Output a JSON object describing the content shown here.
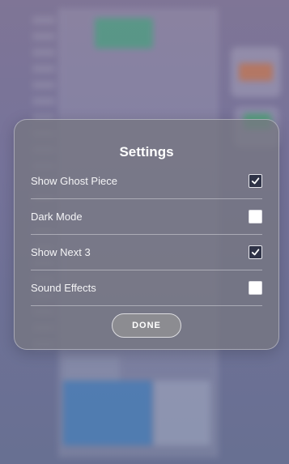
{
  "dialog": {
    "title": "Settings",
    "done_label": "DONE"
  },
  "settings": [
    {
      "label": "Show Ghost Piece",
      "checked": true
    },
    {
      "label": "Dark Mode",
      "checked": false
    },
    {
      "label": "Show Next 3",
      "checked": true
    },
    {
      "label": "Sound Effects",
      "checked": false
    }
  ],
  "colors": {
    "checkbox_checked_bg": "#2f3347",
    "checkbox_unchecked_bg": "#ffffff",
    "modal_bg": "#76767f",
    "button_bg": "#8c8c91"
  }
}
